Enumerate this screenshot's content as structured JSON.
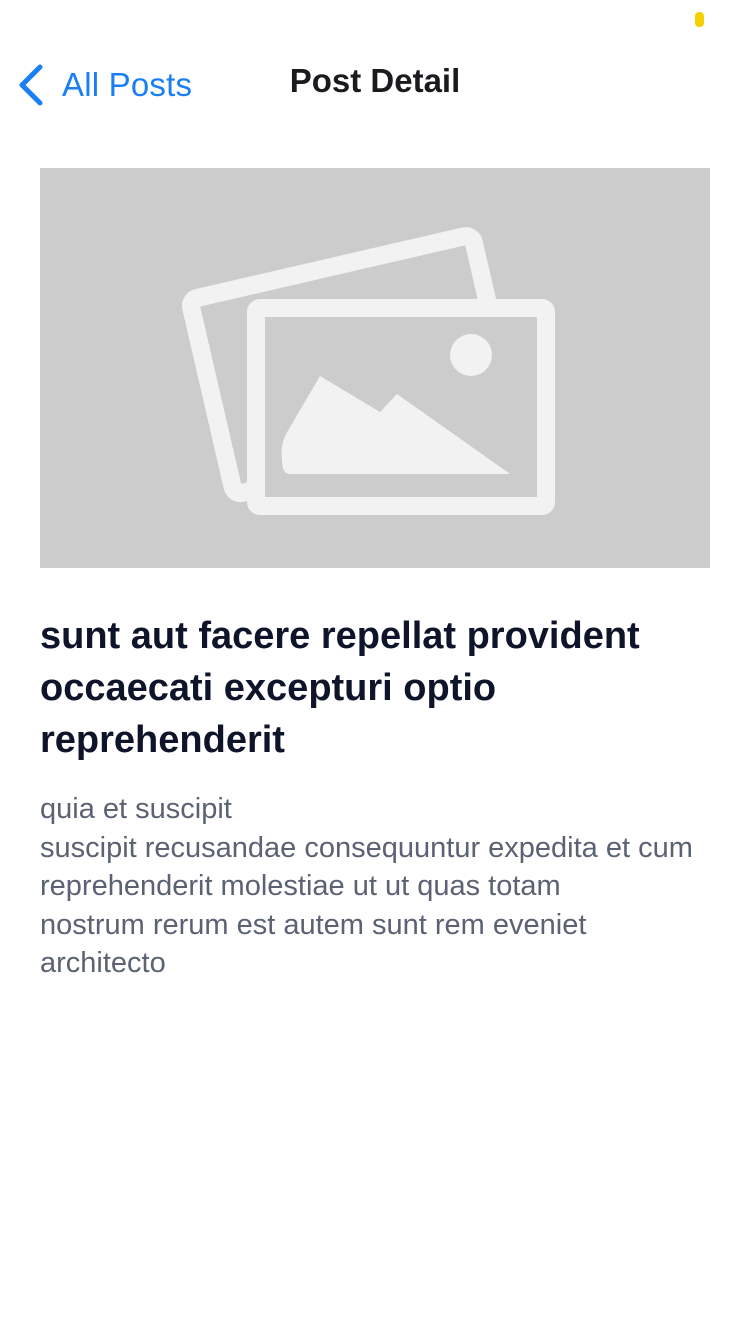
{
  "status_bar": {
    "indicator_color": "#f5d000"
  },
  "nav": {
    "back_label": "All Posts",
    "back_icon": "chevron-left-icon",
    "title": "Post Detail",
    "accent_color": "#1a7ff5"
  },
  "post": {
    "image_icon": "image-placeholder-icon",
    "title": "sunt aut facere repellat provident occaecati excepturi optio reprehenderit",
    "body": "quia et suscipit\nsuscipit recusandae consequuntur expedita et cum\nreprehenderit molestiae ut ut quas totam\nnostrum rerum est autem sunt rem eveniet architecto"
  }
}
